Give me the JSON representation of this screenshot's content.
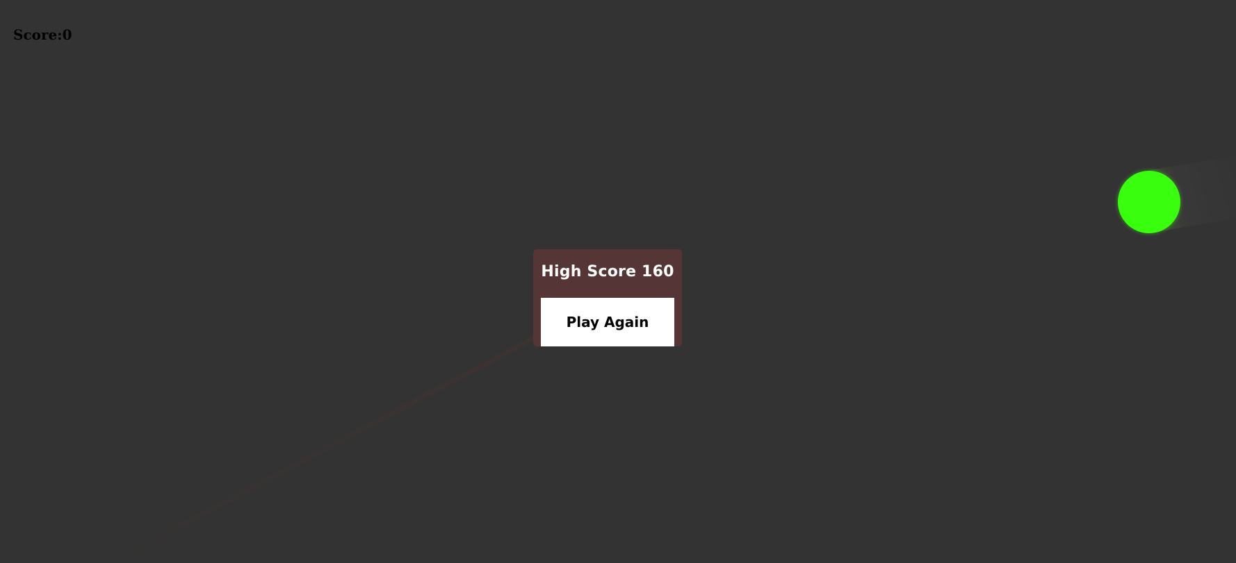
{
  "hud": {
    "score_label": "Score:0"
  },
  "modal": {
    "high_score_text": "High Score 160",
    "play_again_label": "Play Again"
  },
  "colors": {
    "background": "#333333",
    "modal_background": "#553535",
    "player": "#39ff0e",
    "trail": "#3a3a3a",
    "enemy_trail": "#3c3532"
  },
  "icons": {
    "player": "player-circle-icon"
  }
}
